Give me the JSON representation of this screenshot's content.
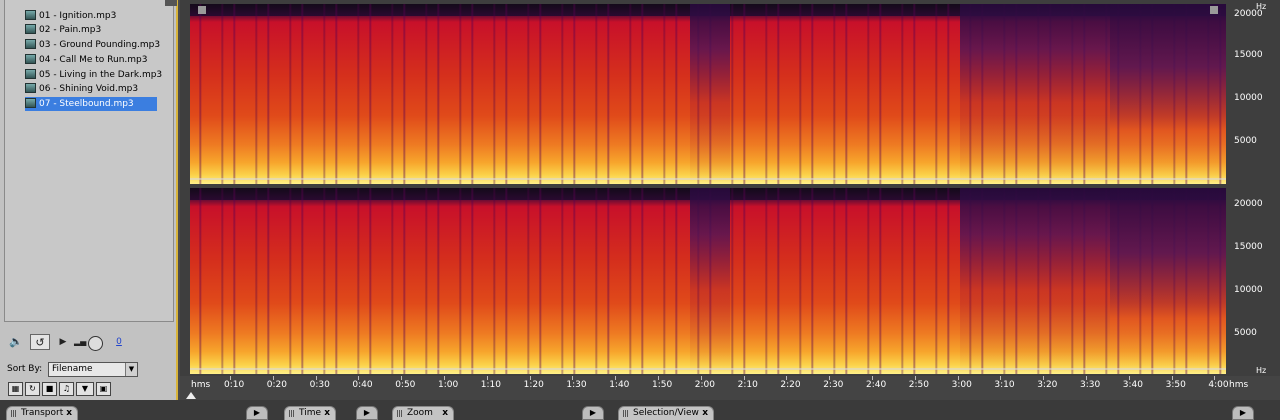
{
  "files": {
    "items": [
      {
        "label": "01 - Ignition.mp3",
        "selected": false
      },
      {
        "label": "02 - Pain.mp3",
        "selected": false
      },
      {
        "label": "03 - Ground Pounding.mp3",
        "selected": false
      },
      {
        "label": "04 - Call Me to Run.mp3",
        "selected": false
      },
      {
        "label": "05 - Living in the Dark.mp3",
        "selected": false
      },
      {
        "label": "06 - Shining Void.mp3",
        "selected": false
      },
      {
        "label": "07 - Steelbound.mp3",
        "selected": true
      }
    ],
    "volume_value": "0",
    "sort_label": "Sort By:",
    "sort_value": "Filename"
  },
  "spectrogram": {
    "freq_unit": "Hz",
    "freq_labels_top": [
      "20000",
      "15000",
      "10000",
      "5000"
    ],
    "freq_labels_bottom": [
      "20000",
      "15000",
      "10000",
      "5000"
    ],
    "time_unit": "hms",
    "time_labels": [
      "0:10",
      "0:20",
      "0:30",
      "0:40",
      "0:50",
      "1:00",
      "1:10",
      "1:20",
      "1:30",
      "1:40",
      "1:50",
      "2:00",
      "2:10",
      "2:20",
      "2:30",
      "2:40",
      "2:50",
      "3:00",
      "3:10",
      "3:20",
      "3:30",
      "3:40",
      "3:50",
      "4:00"
    ],
    "colors": {
      "low": "#fff08a",
      "mid": "#e04a1a",
      "high": "#c8102a",
      "bg": "#1a0a2a"
    }
  },
  "tabs": {
    "transport": "Transport",
    "time": "Time",
    "zoom": "Zoom",
    "selection_view": "Selection/View",
    "close_glyph": "x"
  }
}
